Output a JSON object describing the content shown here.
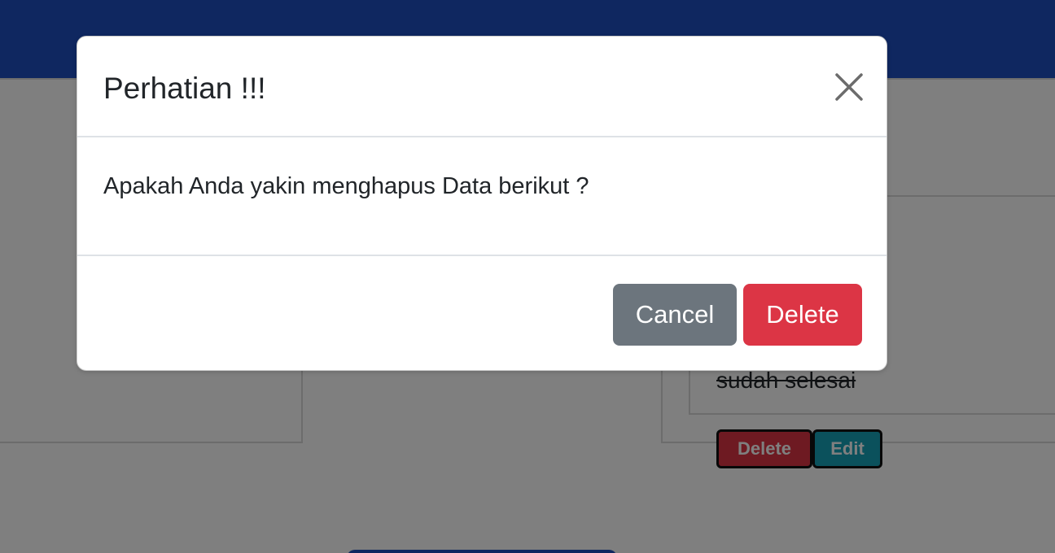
{
  "background": {
    "todo_item_text": "sudah selesai",
    "todo_item_delete_label": "Delete",
    "todo_item_edit_label": "Edit"
  },
  "modal": {
    "title": "Perhatian !!!",
    "close_icon": "close-icon",
    "message": "Apakah Anda yakin menghapus Data berikut ?",
    "cancel_label": "Cancel",
    "delete_label": "Delete"
  },
  "colors": {
    "navbar": "#1e4fc0",
    "cancel_button": "#6c757d",
    "delete_button": "#dc3545",
    "edit_button": "#17a2b8",
    "backdrop": "rgba(0,0,0,0.5)"
  }
}
